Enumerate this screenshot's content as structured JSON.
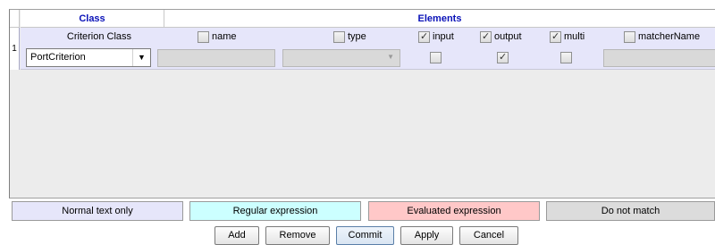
{
  "table": {
    "group_class": "Class",
    "group_elements": "Elements",
    "row_number": "1",
    "columns": {
      "criterion_class": "Criterion Class",
      "name": "name",
      "type": "type",
      "input": "input",
      "output": "output",
      "multi": "multi",
      "matcherName": "matcherName"
    },
    "header_checks": {
      "name": false,
      "type": false,
      "input": true,
      "output": true,
      "multi": true,
      "matcherName": false
    },
    "row": {
      "criterion_class_value": "PortCriterion",
      "input": false,
      "output": true,
      "multi": false
    }
  },
  "legend": {
    "normal": "Normal text only",
    "regex": "Regular expression",
    "evaluated": "Evaluated expression",
    "nomatch": "Do not match"
  },
  "colors": {
    "normal": "#e6e6fa",
    "regex": "#ccffff",
    "evaluated": "#ffc8c8",
    "nomatch": "#dcdcdc",
    "group_header_text": "#0a12b8"
  },
  "buttons": {
    "add": "Add",
    "remove": "Remove",
    "commit": "Commit",
    "apply": "Apply",
    "cancel": "Cancel"
  }
}
